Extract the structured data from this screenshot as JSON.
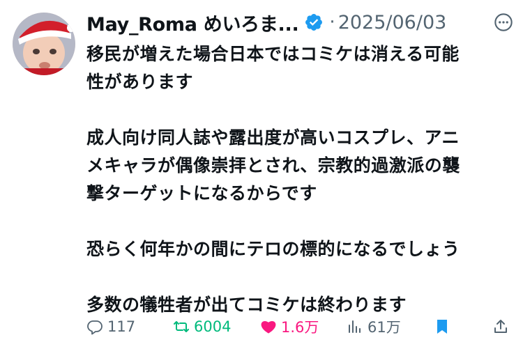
{
  "author": {
    "display_name": "May_Roma めいろま...",
    "avatar_icon": "baby-in-santa-hat-avatar",
    "verified_icon": "verified-badge-icon",
    "verified_color": "#1d9bf0"
  },
  "tweet": {
    "separator": "·",
    "date": "2025/06/03",
    "lines": [
      "移民が増えた場合日本ではコミケは消える可能",
      "性があります",
      "",
      "成人向け同人誌や露出度が高いコスプレ、アニ",
      "メキャラが偶像崇拝とされ、宗教的過激派の襲",
      "撃ターゲットになるからです",
      "",
      "恐らく何年かの間にテロの標的になるでしょう",
      "",
      "多数の犠牲者が出てコミケは終わります"
    ]
  },
  "actions": {
    "reply_count": "117",
    "retweet_count": "6004",
    "like_count": "1.6万",
    "view_count": "61万",
    "retweet_color": "#00ba7c",
    "like_color": "#f91880",
    "bookmark_color": "#1d9bf0",
    "icons": [
      "reply-icon",
      "retweet-icon",
      "heart-icon",
      "views-icon",
      "bookmark-icon",
      "share-icon"
    ]
  }
}
